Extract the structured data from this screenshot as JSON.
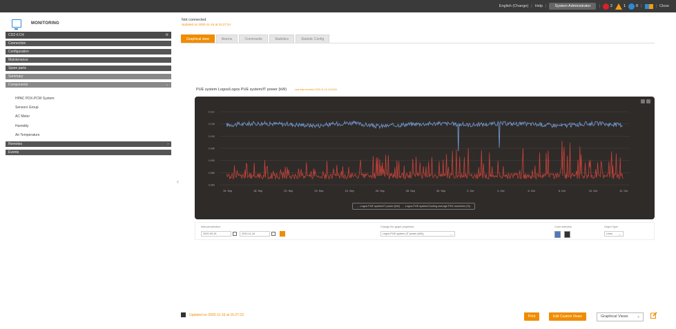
{
  "topbar": {
    "language": "English (Change)",
    "help": "Help",
    "user": "System Administrator",
    "alarm_red_count": "2",
    "alarm_orange_count": "1",
    "alarm_blue_count": "0",
    "close": "Close"
  },
  "sidebar": {
    "title": "MONITORING",
    "site": "CDZ-6 DX",
    "groups": [
      {
        "label": "Connection"
      },
      {
        "label": "Configuration"
      },
      {
        "label": "Maintenance"
      },
      {
        "label": "Spare parts"
      },
      {
        "label": "Summary"
      },
      {
        "label": "Components"
      }
    ],
    "components": [
      "HPAC PDX-PCW System",
      "Sensors Group",
      "AC Meter",
      "Humidity",
      "Air Temperature"
    ],
    "remotes": "Remotes",
    "events": "Events"
  },
  "main": {
    "status_title": "Not connected",
    "status_sub": "Updated on 2020-11-16 at 15:27:24",
    "tabs": [
      "Graphical view",
      "Alarms",
      "Commands",
      "Statistics",
      "Statistic Config"
    ],
    "graph_title": "PUE system Logos/Logos PUE system/IT power (kW)",
    "graph_subtitle": "Last data received 2020-11-16 15:26:51"
  },
  "chart_data": {
    "type": "line",
    "title": "",
    "x": [
      "15. Sep",
      "18. Sep",
      "20. Sep",
      "22. Sep",
      "24. Sep",
      "26. Sep",
      "28. Sep",
      "30. Sep",
      "2. Oct",
      "4. Oct",
      "6. Oct",
      "8. Oct",
      "10. Oct",
      "12. Oct"
    ],
    "series": [
      {
        "name": "Logos PUE system/IT power (kW)",
        "color": "#6f95c9",
        "values": [
          0.82,
          0.84,
          0.83,
          0.81,
          0.85,
          0.8,
          0.83,
          0.84,
          0.82,
          0.84,
          0.83,
          0.81,
          0.84,
          0.82
        ]
      },
      {
        "name": "Logos PUE system/Cooling average PDX machines (%)",
        "color": "#c8433a",
        "values": [
          0.2,
          0.25,
          0.15,
          0.22,
          0.18,
          0.3,
          0.28,
          0.35,
          0.4,
          0.45,
          0.38,
          0.5,
          0.42,
          0.35
        ]
      }
    ],
    "yticks_left": [
      "0.060",
      "0.085",
      "0.090",
      "0.095",
      "0.100",
      "0.105",
      "0.110"
    ],
    "ylim": [
      0,
      1
    ],
    "grid": true,
    "legend_position": "bottom"
  },
  "controls": {
    "interval_label": "Interval selection",
    "from": "2020-09-15",
    "to": "2020-11-16",
    "property_label": "Change the graph properties",
    "property_value": "Logos PUE system (IT power (kW))",
    "color_label": "Color selection",
    "graph_type_label": "Graph Type",
    "graph_type_value": "Lines"
  },
  "footer": {
    "updated": "Updated on 2020-11-16 at 15:27:23",
    "print": "Print",
    "edit_custom": "Edit Custom Views",
    "views": "Graphical Views"
  }
}
